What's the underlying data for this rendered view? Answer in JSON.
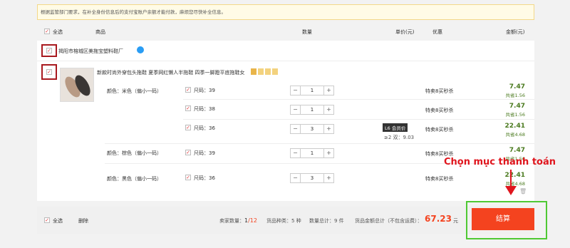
{
  "notice": {
    "text": "根据监管部门要求，在补全身份信息后的支付宝账户余额才能付款，麻烦您尽快补全信息。"
  },
  "header": {
    "select_all": "全选",
    "goods": "商品",
    "quantity": "数量",
    "unit_price": "单价(元)",
    "discount": "优惠",
    "amount": "金额(元)"
  },
  "shop": {
    "name": "揭阳市榕城区美拖宝塑料鞋厂"
  },
  "product": {
    "title": "新款时尚外穿包头拖鞋 夏季网红懒人半拖鞋 四季一脚蹬平底拖鞋女"
  },
  "items": [
    {
      "color": "颜色：米色（偏小一码）",
      "size": "尺码：39",
      "qty": "1",
      "promo": "特卖8买秒杀",
      "price": "7.47",
      "save": "共省1.56"
    },
    {
      "color": "",
      "size": "尺码：38",
      "qty": "1",
      "promo": "特卖8买秒杀",
      "price": "7.47",
      "save": "共省1.56"
    },
    {
      "color": "",
      "size": "尺码：36",
      "qty": "3",
      "promo": "特卖8买秒杀",
      "price": "22.41",
      "save": "共省4.68",
      "member_badge": "L6 会员价",
      "tier": "≥2 双：9.03"
    },
    {
      "color": "颜色：棕色（偏小一码）",
      "size": "尺码：39",
      "qty": "1",
      "promo": "特卖8买秒杀",
      "price": "7.47",
      "save": "共省1.56"
    },
    {
      "color": "颜色：黑色（偏小一码）",
      "size": "尺码：36",
      "qty": "3",
      "promo": "特卖8买秒杀",
      "price": "22.41",
      "save": "共省4.68"
    }
  ],
  "stepper": {
    "minus": "−",
    "plus": "+"
  },
  "footer": {
    "select_all": "全选",
    "delete": "删除",
    "seller_count_label": "卖家数量：",
    "seller_count": "1",
    "seller_total": "/12",
    "kinds": "货品种类：5 种",
    "qty_total": "数量总计：9 件",
    "goods_total_label": "货品金额总计（不包含运费）：",
    "goods_total": "67.23",
    "currency": "元",
    "checkout": "结算"
  },
  "annotation": {
    "text": "Chọn mục thanh toán"
  },
  "colors": {
    "accent": "#f4431f",
    "price": "#4a7a1e",
    "highlight_red": "#a8191f",
    "highlight_green": "#4fc934"
  }
}
